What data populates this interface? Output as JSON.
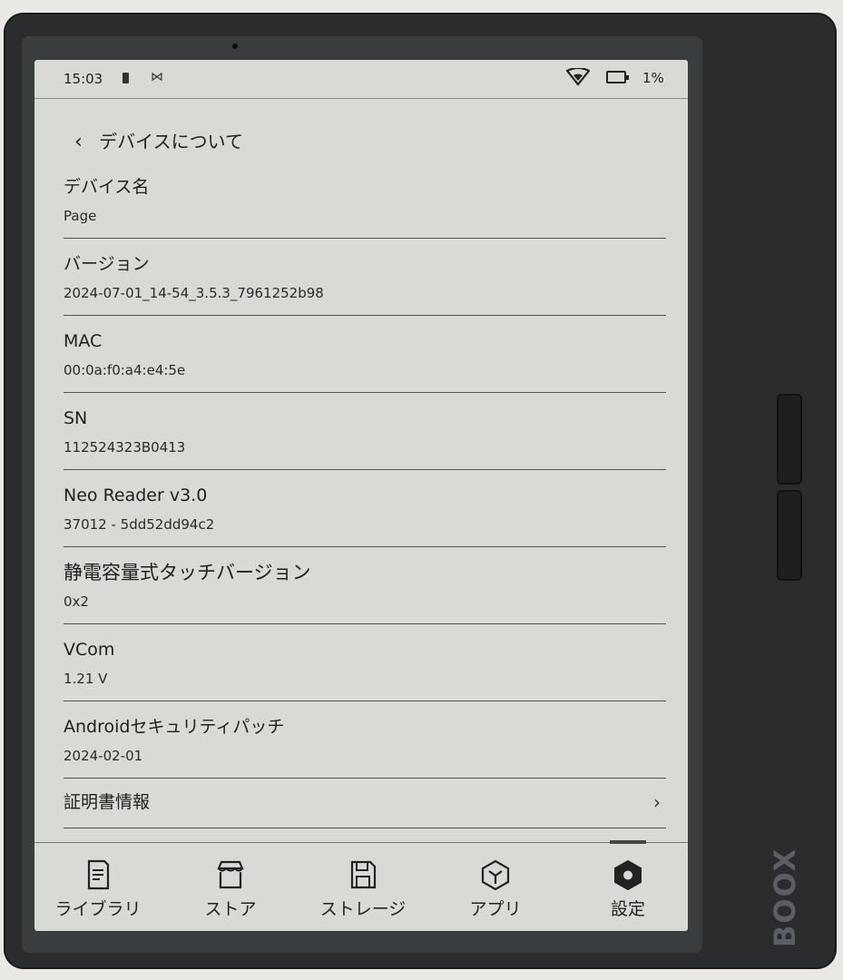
{
  "statusbar": {
    "time": "15:03",
    "battery_percent": "1%",
    "icons": [
      "battery-small-icon",
      "mail-icon",
      "wifi-icon",
      "battery-icon"
    ]
  },
  "header": {
    "title": "デバイスについて"
  },
  "items": [
    {
      "label": "デバイス名",
      "value": "Page"
    },
    {
      "label": "バージョン",
      "value": "2024-07-01_14-54_3.5.3_7961252b98"
    },
    {
      "label": "MAC",
      "value": "00:0a:f0:a4:e4:5e"
    },
    {
      "label": "SN",
      "value": "112524323B0413"
    },
    {
      "label": "Neo Reader v3.0",
      "value": "37012 - 5dd52dd94c2"
    },
    {
      "label": "静電容量式タッチバージョン",
      "value": "0x2"
    },
    {
      "label": "VCom",
      "value": "1.21 V"
    },
    {
      "label": "Androidセキュリティパッチ",
      "value": "2024-02-01"
    }
  ],
  "cert_link": {
    "label": "証明書情報"
  },
  "nav": {
    "items": [
      {
        "label": "ライブラリ",
        "icon": "library-icon"
      },
      {
        "label": "ストア",
        "icon": "store-icon"
      },
      {
        "label": "ストレージ",
        "icon": "storage-icon"
      },
      {
        "label": "アプリ",
        "icon": "apps-icon"
      },
      {
        "label": "設定",
        "icon": "settings-icon"
      }
    ],
    "active_index": 4
  },
  "brand": "BOOX"
}
